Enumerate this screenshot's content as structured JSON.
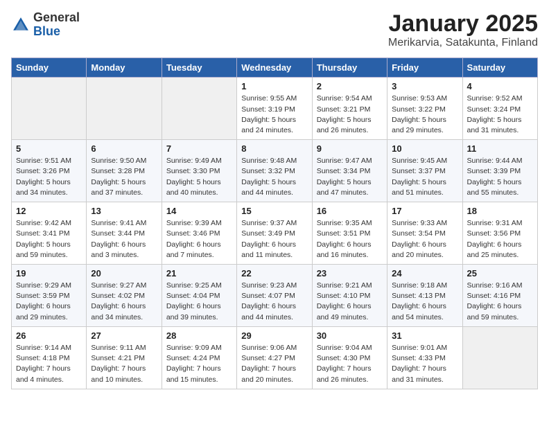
{
  "logo": {
    "general": "General",
    "blue": "Blue"
  },
  "title": "January 2025",
  "subtitle": "Merikarvia, Satakunta, Finland",
  "days_of_week": [
    "Sunday",
    "Monday",
    "Tuesday",
    "Wednesday",
    "Thursday",
    "Friday",
    "Saturday"
  ],
  "weeks": [
    [
      {
        "day": "",
        "info": ""
      },
      {
        "day": "",
        "info": ""
      },
      {
        "day": "",
        "info": ""
      },
      {
        "day": "1",
        "info": "Sunrise: 9:55 AM\nSunset: 3:19 PM\nDaylight: 5 hours\nand 24 minutes."
      },
      {
        "day": "2",
        "info": "Sunrise: 9:54 AM\nSunset: 3:21 PM\nDaylight: 5 hours\nand 26 minutes."
      },
      {
        "day": "3",
        "info": "Sunrise: 9:53 AM\nSunset: 3:22 PM\nDaylight: 5 hours\nand 29 minutes."
      },
      {
        "day": "4",
        "info": "Sunrise: 9:52 AM\nSunset: 3:24 PM\nDaylight: 5 hours\nand 31 minutes."
      }
    ],
    [
      {
        "day": "5",
        "info": "Sunrise: 9:51 AM\nSunset: 3:26 PM\nDaylight: 5 hours\nand 34 minutes."
      },
      {
        "day": "6",
        "info": "Sunrise: 9:50 AM\nSunset: 3:28 PM\nDaylight: 5 hours\nand 37 minutes."
      },
      {
        "day": "7",
        "info": "Sunrise: 9:49 AM\nSunset: 3:30 PM\nDaylight: 5 hours\nand 40 minutes."
      },
      {
        "day": "8",
        "info": "Sunrise: 9:48 AM\nSunset: 3:32 PM\nDaylight: 5 hours\nand 44 minutes."
      },
      {
        "day": "9",
        "info": "Sunrise: 9:47 AM\nSunset: 3:34 PM\nDaylight: 5 hours\nand 47 minutes."
      },
      {
        "day": "10",
        "info": "Sunrise: 9:45 AM\nSunset: 3:37 PM\nDaylight: 5 hours\nand 51 minutes."
      },
      {
        "day": "11",
        "info": "Sunrise: 9:44 AM\nSunset: 3:39 PM\nDaylight: 5 hours\nand 55 minutes."
      }
    ],
    [
      {
        "day": "12",
        "info": "Sunrise: 9:42 AM\nSunset: 3:41 PM\nDaylight: 5 hours\nand 59 minutes."
      },
      {
        "day": "13",
        "info": "Sunrise: 9:41 AM\nSunset: 3:44 PM\nDaylight: 6 hours\nand 3 minutes."
      },
      {
        "day": "14",
        "info": "Sunrise: 9:39 AM\nSunset: 3:46 PM\nDaylight: 6 hours\nand 7 minutes."
      },
      {
        "day": "15",
        "info": "Sunrise: 9:37 AM\nSunset: 3:49 PM\nDaylight: 6 hours\nand 11 minutes."
      },
      {
        "day": "16",
        "info": "Sunrise: 9:35 AM\nSunset: 3:51 PM\nDaylight: 6 hours\nand 16 minutes."
      },
      {
        "day": "17",
        "info": "Sunrise: 9:33 AM\nSunset: 3:54 PM\nDaylight: 6 hours\nand 20 minutes."
      },
      {
        "day": "18",
        "info": "Sunrise: 9:31 AM\nSunset: 3:56 PM\nDaylight: 6 hours\nand 25 minutes."
      }
    ],
    [
      {
        "day": "19",
        "info": "Sunrise: 9:29 AM\nSunset: 3:59 PM\nDaylight: 6 hours\nand 29 minutes."
      },
      {
        "day": "20",
        "info": "Sunrise: 9:27 AM\nSunset: 4:02 PM\nDaylight: 6 hours\nand 34 minutes."
      },
      {
        "day": "21",
        "info": "Sunrise: 9:25 AM\nSunset: 4:04 PM\nDaylight: 6 hours\nand 39 minutes."
      },
      {
        "day": "22",
        "info": "Sunrise: 9:23 AM\nSunset: 4:07 PM\nDaylight: 6 hours\nand 44 minutes."
      },
      {
        "day": "23",
        "info": "Sunrise: 9:21 AM\nSunset: 4:10 PM\nDaylight: 6 hours\nand 49 minutes."
      },
      {
        "day": "24",
        "info": "Sunrise: 9:18 AM\nSunset: 4:13 PM\nDaylight: 6 hours\nand 54 minutes."
      },
      {
        "day": "25",
        "info": "Sunrise: 9:16 AM\nSunset: 4:16 PM\nDaylight: 6 hours\nand 59 minutes."
      }
    ],
    [
      {
        "day": "26",
        "info": "Sunrise: 9:14 AM\nSunset: 4:18 PM\nDaylight: 7 hours\nand 4 minutes."
      },
      {
        "day": "27",
        "info": "Sunrise: 9:11 AM\nSunset: 4:21 PM\nDaylight: 7 hours\nand 10 minutes."
      },
      {
        "day": "28",
        "info": "Sunrise: 9:09 AM\nSunset: 4:24 PM\nDaylight: 7 hours\nand 15 minutes."
      },
      {
        "day": "29",
        "info": "Sunrise: 9:06 AM\nSunset: 4:27 PM\nDaylight: 7 hours\nand 20 minutes."
      },
      {
        "day": "30",
        "info": "Sunrise: 9:04 AM\nSunset: 4:30 PM\nDaylight: 7 hours\nand 26 minutes."
      },
      {
        "day": "31",
        "info": "Sunrise: 9:01 AM\nSunset: 4:33 PM\nDaylight: 7 hours\nand 31 minutes."
      },
      {
        "day": "",
        "info": ""
      }
    ]
  ]
}
